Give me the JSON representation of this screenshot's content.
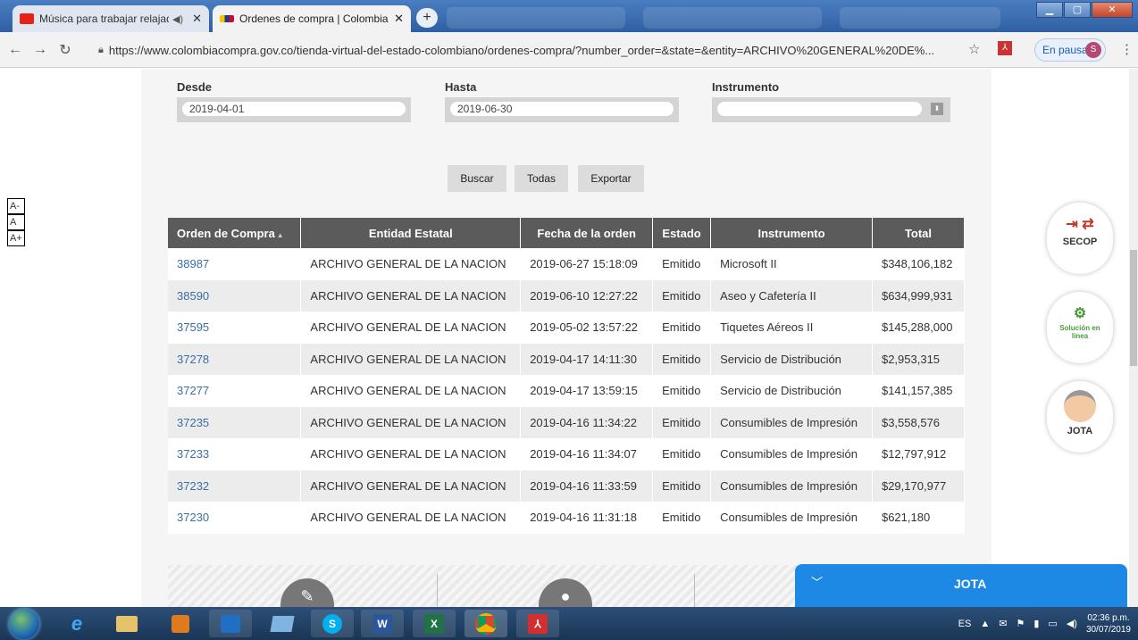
{
  "browser": {
    "tabs": [
      {
        "title": "Música para trabajar relajado",
        "active": false
      },
      {
        "title": "Ordenes de compra | Colombia C",
        "active": true
      }
    ],
    "url": "https://www.colombiacompra.gov.co/tienda-virtual-del-estado-colombiano/ordenes-compra/?number_order=&state=&entity=ARCHIVO%20GENERAL%20DE%...",
    "profile_status": "En pausa",
    "profile_initial": "S"
  },
  "filters": {
    "desde_label": "Desde",
    "desde_value": "2019-04-01",
    "hasta_label": "Hasta",
    "hasta_value": "2019-06-30",
    "instrumento_label": "Instrumento",
    "instrumento_value": ""
  },
  "actions": {
    "buscar": "Buscar",
    "todas": "Todas",
    "exportar": "Exportar"
  },
  "font_sizer": [
    "A-",
    "A",
    "A+"
  ],
  "table": {
    "headers": [
      "Orden de Compra",
      "Entidad Estatal",
      "Fecha de la orden",
      "Estado",
      "Instrumento",
      "Total"
    ],
    "rows": [
      [
        "38987",
        "ARCHIVO GENERAL DE LA NACION",
        "2019-06-27 15:18:09",
        "Emitido",
        "Microsoft II",
        "$348,106,182"
      ],
      [
        "38590",
        "ARCHIVO GENERAL DE LA NACION",
        "2019-06-10 12:27:22",
        "Emitido",
        "Aseo y Cafetería II",
        "$634,999,931"
      ],
      [
        "37595",
        "ARCHIVO GENERAL DE LA NACION",
        "2019-05-02 13:57:22",
        "Emitido",
        "Tiquetes Aéreos II",
        "$145,288,000"
      ],
      [
        "37278",
        "ARCHIVO GENERAL DE LA NACION",
        "2019-04-17 14:11:30",
        "Emitido",
        "Servicio de Distribución",
        "$2,953,315"
      ],
      [
        "37277",
        "ARCHIVO GENERAL DE LA NACION",
        "2019-04-17 13:59:15",
        "Emitido",
        "Servicio de Distribución",
        "$141,157,385"
      ],
      [
        "37235",
        "ARCHIVO GENERAL DE LA NACION",
        "2019-04-16 11:34:22",
        "Emitido",
        "Consumibles de Impresión",
        "$3,558,576"
      ],
      [
        "37233",
        "ARCHIVO GENERAL DE LA NACION",
        "2019-04-16 11:34:07",
        "Emitido",
        "Consumibles de Impresión",
        "$12,797,912"
      ],
      [
        "37232",
        "ARCHIVO GENERAL DE LA NACION",
        "2019-04-16 11:33:59",
        "Emitido",
        "Consumibles de Impresión",
        "$29,170,977"
      ],
      [
        "37230",
        "ARCHIVO GENERAL DE LA NACION",
        "2019-04-16 11:31:18",
        "Emitido",
        "Consumibles de Impresión",
        "$621,180"
      ]
    ]
  },
  "side": {
    "secop": "SECOP",
    "solucion": "Solución en línea",
    "jota": "JOTA"
  },
  "chat": {
    "title": "JOTA"
  },
  "taskbar": {
    "lang": "ES",
    "time": "02:36 p.m.",
    "date": "30/07/2019"
  },
  "colors": {
    "header_bg": "#5b5b5b",
    "link": "#3a6ea5",
    "chat": "#1e88e5",
    "secop_icon": "#c0392b"
  }
}
